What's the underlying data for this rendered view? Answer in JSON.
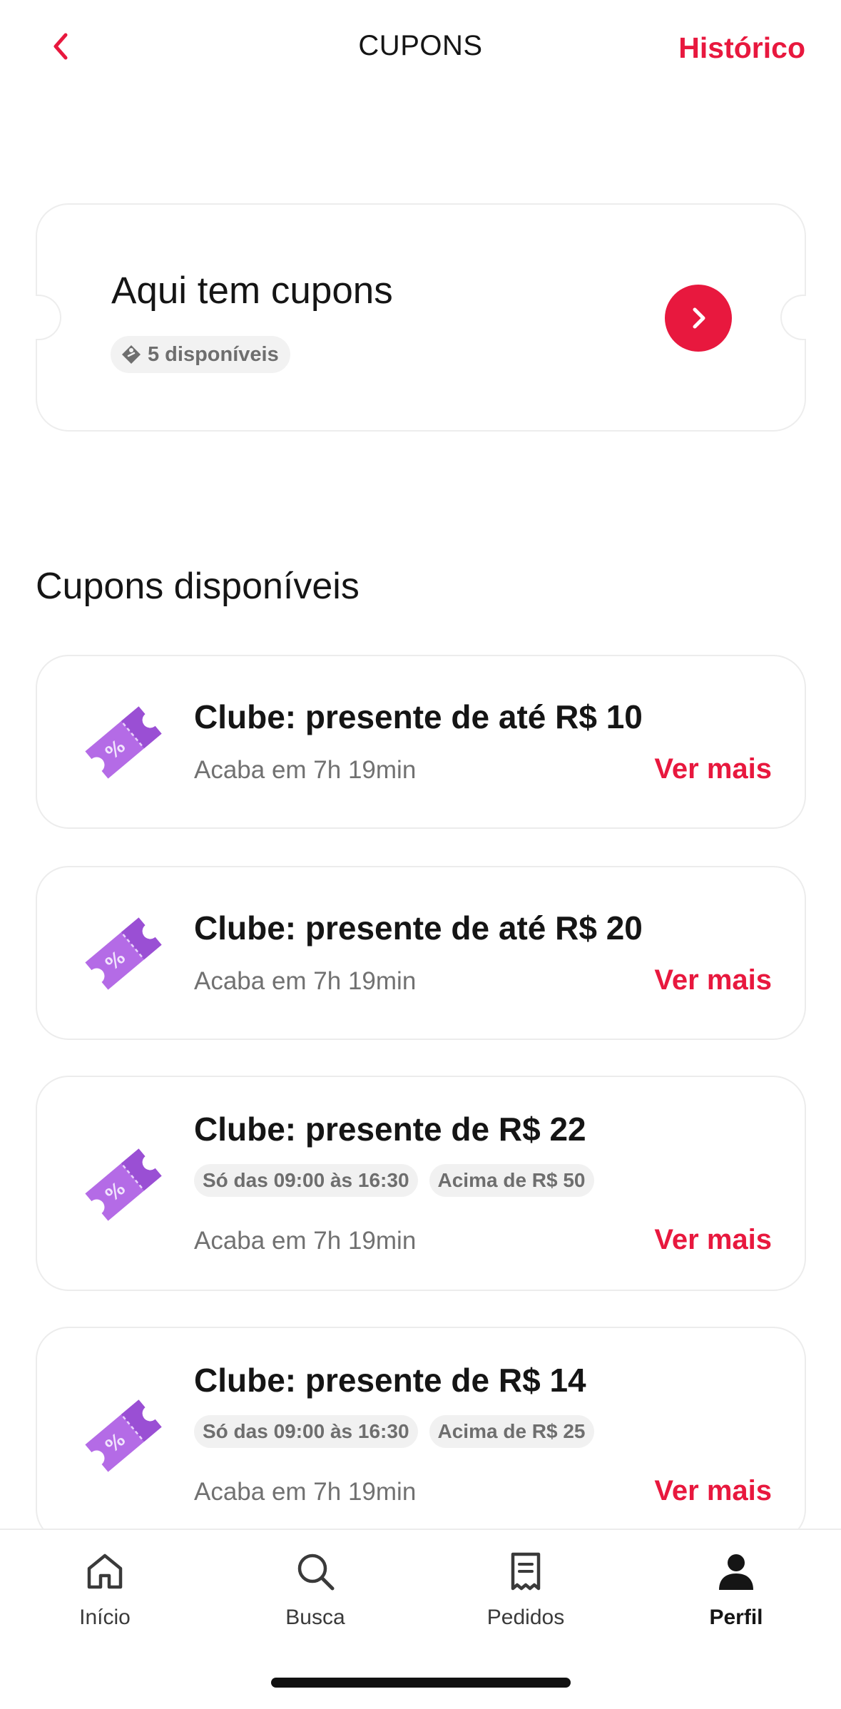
{
  "header": {
    "title": "CUPONS",
    "history_label": "Histórico"
  },
  "promo": {
    "title": "Aqui tem cupons",
    "badge_label": "5 disponíveis"
  },
  "section_title": "Cupons disponíveis",
  "coupons": [
    {
      "title": "Clube: presente de até R$ 10",
      "expiry": "Acaba em 7h 19min",
      "action": "Ver mais",
      "tags": []
    },
    {
      "title": "Clube: presente de até R$ 20",
      "expiry": "Acaba em 7h 19min",
      "action": "Ver mais",
      "tags": []
    },
    {
      "title": "Clube: presente de R$ 22",
      "expiry": "Acaba em 7h 19min",
      "action": "Ver mais",
      "tags": [
        "Só das 09:00 às 16:30",
        "Acima de R$ 50"
      ]
    },
    {
      "title": "Clube: presente de R$ 14",
      "expiry": "Acaba em 7h 19min",
      "action": "Ver mais",
      "tags": [
        "Só das 09:00 às 16:30",
        "Acima de R$ 25"
      ]
    }
  ],
  "nav": {
    "items": [
      {
        "label": "Início",
        "icon": "home-icon",
        "active": false
      },
      {
        "label": "Busca",
        "icon": "search-icon",
        "active": false
      },
      {
        "label": "Pedidos",
        "icon": "receipt-icon",
        "active": false
      },
      {
        "label": "Perfil",
        "icon": "profile-icon",
        "active": true
      }
    ]
  },
  "colors": {
    "accent": "#e8183e",
    "coupon_icon": "#b46be6"
  }
}
